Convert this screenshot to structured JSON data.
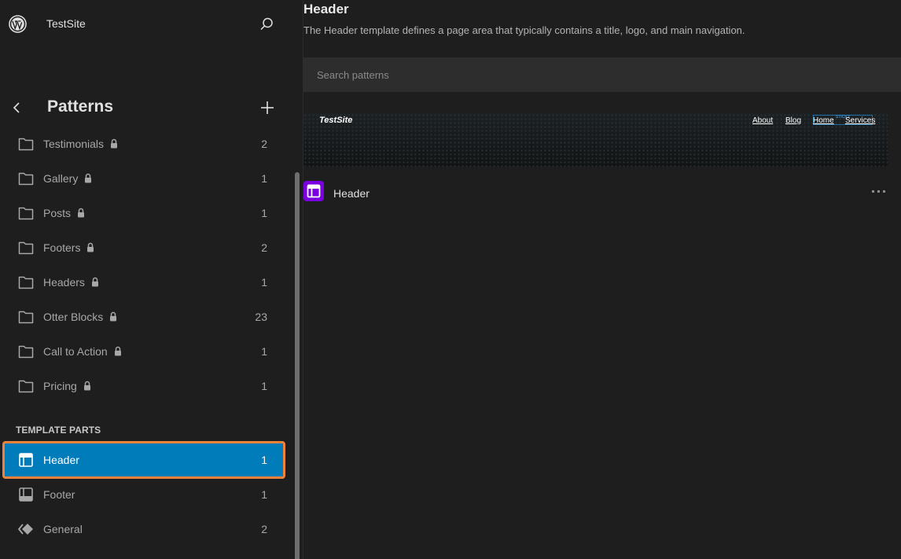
{
  "site": {
    "name": "TestSite",
    "logo_icon": "wordpress-logo-icon",
    "search_icon": "search-icon"
  },
  "nav": {
    "title": "Patterns",
    "back_icon": "chevron-left-icon",
    "add_icon": "plus-icon"
  },
  "categories": [
    {
      "label": "Testimonials",
      "count": "2",
      "icon": "folder-icon",
      "locked": true
    },
    {
      "label": "Gallery",
      "count": "1",
      "icon": "folder-icon",
      "locked": true
    },
    {
      "label": "Posts",
      "count": "1",
      "icon": "folder-icon",
      "locked": true
    },
    {
      "label": "Footers",
      "count": "2",
      "icon": "folder-icon",
      "locked": true
    },
    {
      "label": "Headers",
      "count": "1",
      "icon": "folder-icon",
      "locked": true
    },
    {
      "label": "Otter Blocks",
      "count": "23",
      "icon": "folder-icon",
      "locked": true
    },
    {
      "label": "Call to Action",
      "count": "1",
      "icon": "folder-icon",
      "locked": true
    },
    {
      "label": "Pricing",
      "count": "1",
      "icon": "folder-icon",
      "locked": true
    }
  ],
  "template_parts": {
    "section_label": "TEMPLATE PARTS",
    "items": [
      {
        "label": "Header",
        "count": "1",
        "icon": "header-icon",
        "active": true
      },
      {
        "label": "Footer",
        "count": "1",
        "icon": "footer-icon",
        "active": false
      },
      {
        "label": "General",
        "count": "2",
        "icon": "symbol-icon",
        "active": false
      }
    ]
  },
  "main": {
    "title": "Header",
    "description": "The Header template defines a page area that typically contains a title, logo, and main navigation.",
    "search": {
      "placeholder": "Search patterns",
      "value": ""
    },
    "preview": {
      "site_title": "TestSite",
      "nav_links": [
        "About",
        "Blog",
        "Home",
        "Services"
      ],
      "sticky_label": "STICKY"
    },
    "patterns": [
      {
        "name": "Header",
        "icon": "header-icon",
        "menu_icon": "more-horizontal-icon"
      }
    ]
  },
  "colors": {
    "accent": "#007cba",
    "highlight": "#f0823a",
    "pattern_icon_bg": "#7a00df",
    "background": "#1e1e1e"
  }
}
